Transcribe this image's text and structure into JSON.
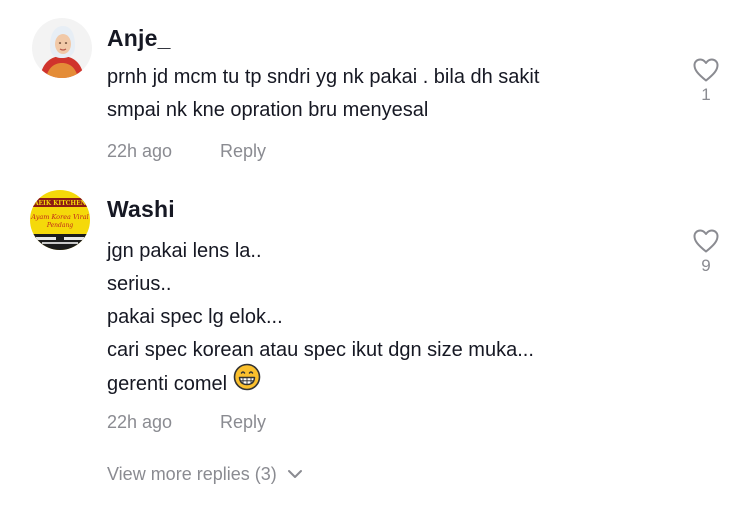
{
  "comments": [
    {
      "username": "Anje_",
      "lines": [
        "prnh jd mcm tu tp sndri yg nk pakai . bila dh sakit",
        "smpai nk kne opration bru menyesal"
      ],
      "time": "22h ago",
      "reply_label": "Reply",
      "likes": "1",
      "avatar_icon": "profile-photo-woman-hijab"
    },
    {
      "username": "Washi",
      "lines": [
        "jgn pakai lens la..",
        "serius..",
        "pakai spec lg elok...",
        "cari spec korean atau spec ikut dgn size muka...",
        "gerenti comel"
      ],
      "time": "22h ago",
      "reply_label": "Reply",
      "likes": "9",
      "avatar_icon": "aeik-kitchen-logo",
      "avatar_text": [
        "AEIK KITCHEN",
        "Ayam Korea Viral",
        "Pendang"
      ],
      "emoji_icon": "grinning-face-emoji"
    }
  ],
  "view_more": {
    "label": "View more replies (3)",
    "icon": "chevron-down-icon"
  },
  "colors": {
    "primary_text": "#161823",
    "secondary_text": "#8a8b91",
    "icon_gray": "#8a8b91"
  }
}
